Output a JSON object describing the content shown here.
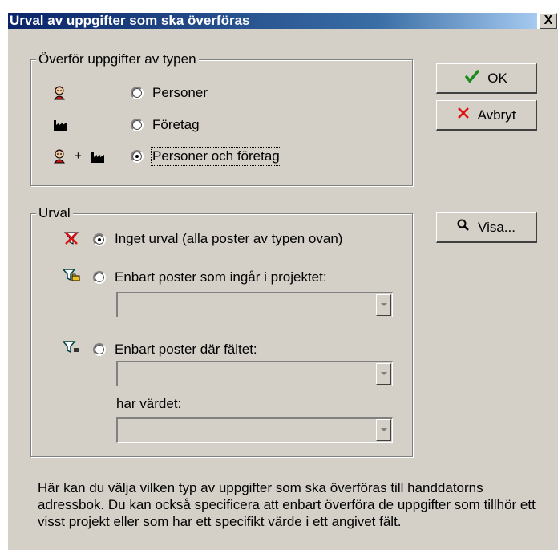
{
  "dialog": {
    "title": "Urval av uppgifter som ska överföras",
    "close_label": "X"
  },
  "type_group": {
    "legend": "Överför uppgifter av typen",
    "options": [
      {
        "label": "Personer",
        "checked": false,
        "icon": "person-icon"
      },
      {
        "label": "Företag",
        "checked": false,
        "icon": "factory-icon"
      },
      {
        "label": "Personer och företag",
        "checked": true,
        "icon": "person-and-factory-icon",
        "plus": "+"
      }
    ]
  },
  "buttons": {
    "ok_label": "OK",
    "cancel_label": "Avbryt",
    "show_label": "Visa..."
  },
  "selection_group": {
    "legend": "Urval",
    "options": [
      {
        "label": "Inget urval (alla poster av typen ovan)",
        "checked": true,
        "icon": "no-filter-icon"
      },
      {
        "label": "Enbart poster som ingår i projektet:",
        "checked": false,
        "icon": "filter-project-icon"
      },
      {
        "label": "Enbart poster där fältet:",
        "checked": false,
        "icon": "filter-equals-icon"
      }
    ],
    "project_select_value": "",
    "field_select_value": "",
    "value_label": "har värdet:",
    "value_select_value": ""
  },
  "description": "Här kan du välja vilken typ av uppgifter som ska överföras till handdatorns adressbok. Du kan också specificera att enbart överföra de uppgifter som tillhör ett visst projekt eller som har ett specifikt värde i ett angivet fält.",
  "colors": {
    "face": "#d4d0c8",
    "title_start": "#0a246a",
    "title_end": "#a6caf0",
    "ok_check": "#1d8a1d",
    "cancel_x": "#e01010"
  }
}
